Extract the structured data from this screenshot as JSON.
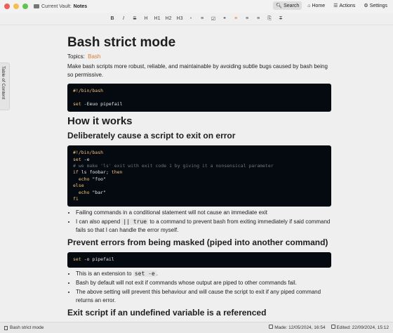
{
  "titlebar": {
    "vault_label": "Current Vault:",
    "vault_name": "Notes",
    "search_label": "Search",
    "home_label": "Home",
    "actions_label": "Actions",
    "settings_label": "Settings",
    "traffic_colors": [
      "#ee5f57",
      "#f5be4f",
      "#5fc454"
    ]
  },
  "toolbar": {
    "buttons": [
      "B",
      "I",
      "S",
      "H",
      "H1",
      "H2",
      "H3",
      "•",
      "≡",
      "☑",
      "❝",
      "≡",
      "≡",
      "≡",
      "⎘",
      "T"
    ]
  },
  "sidebar": {
    "toc_label": "Table of Content"
  },
  "doc": {
    "title": "Bash strict mode",
    "topics_label": "Topics:",
    "topic_tag": "Bash",
    "intro": "Make bash scripts more robust, reliable, and maintainable by avoiding subtle bugs caused by bash being so permissive.",
    "code1": {
      "line1": "#!/bin/bash",
      "line2": "",
      "line3_kw": "set",
      "line3_rest": " -Eeuo pipefail"
    },
    "h2_how": "How it works",
    "h3_deliberate": "Deliberately cause a script to exit on error",
    "code2": {
      "l1": "#!/bin/bash",
      "l2_kw": "set",
      "l2_rest": " -e",
      "l3_comment": "# we make 'ls' exit with exit code 1 by giving it a nonsensical parameter",
      "l4_kw": "if",
      "l4_mid": " ls foobar; ",
      "l4_kw2": "then",
      "l5_kw": "echo",
      "l5_rest": " \"foo\"",
      "l6_kw": "else",
      "l7_kw": "echo",
      "l7_rest": " \"bar\"",
      "l8_kw": "fi"
    },
    "bullets1": [
      "Failing commands in a conditional statement will not cause an immediate exit"
    ],
    "bullet2_pre": "I can also append ",
    "bullet2_code": "|| true",
    "bullet2_post": " to a command to prevent bash from exiting immediately if said command fails so that I can handle the error myself.",
    "h3_prevent": "Prevent errors from being masked (piped into another command)",
    "code3": {
      "kw": "set",
      "rest": " -o pipefail"
    },
    "bullet3_pre": "This is an extension to ",
    "bullet3_code": "set -e",
    "bullet3_post": ".",
    "bullets4": [
      "Bash by default will not exit if commands whose output are piped to other commands fail.",
      "The above setting will prevent this behaviour and will cause the script to exit if any piped command returns an error."
    ],
    "h3_exit": "Exit script if an undefined variable is a referenced"
  },
  "statusbar": {
    "doc_name": "Bash strict mode",
    "made_label": "Made: 12/05/2024, 16:54",
    "edited_label": "Edited: 22/09/2024, 15:12"
  }
}
